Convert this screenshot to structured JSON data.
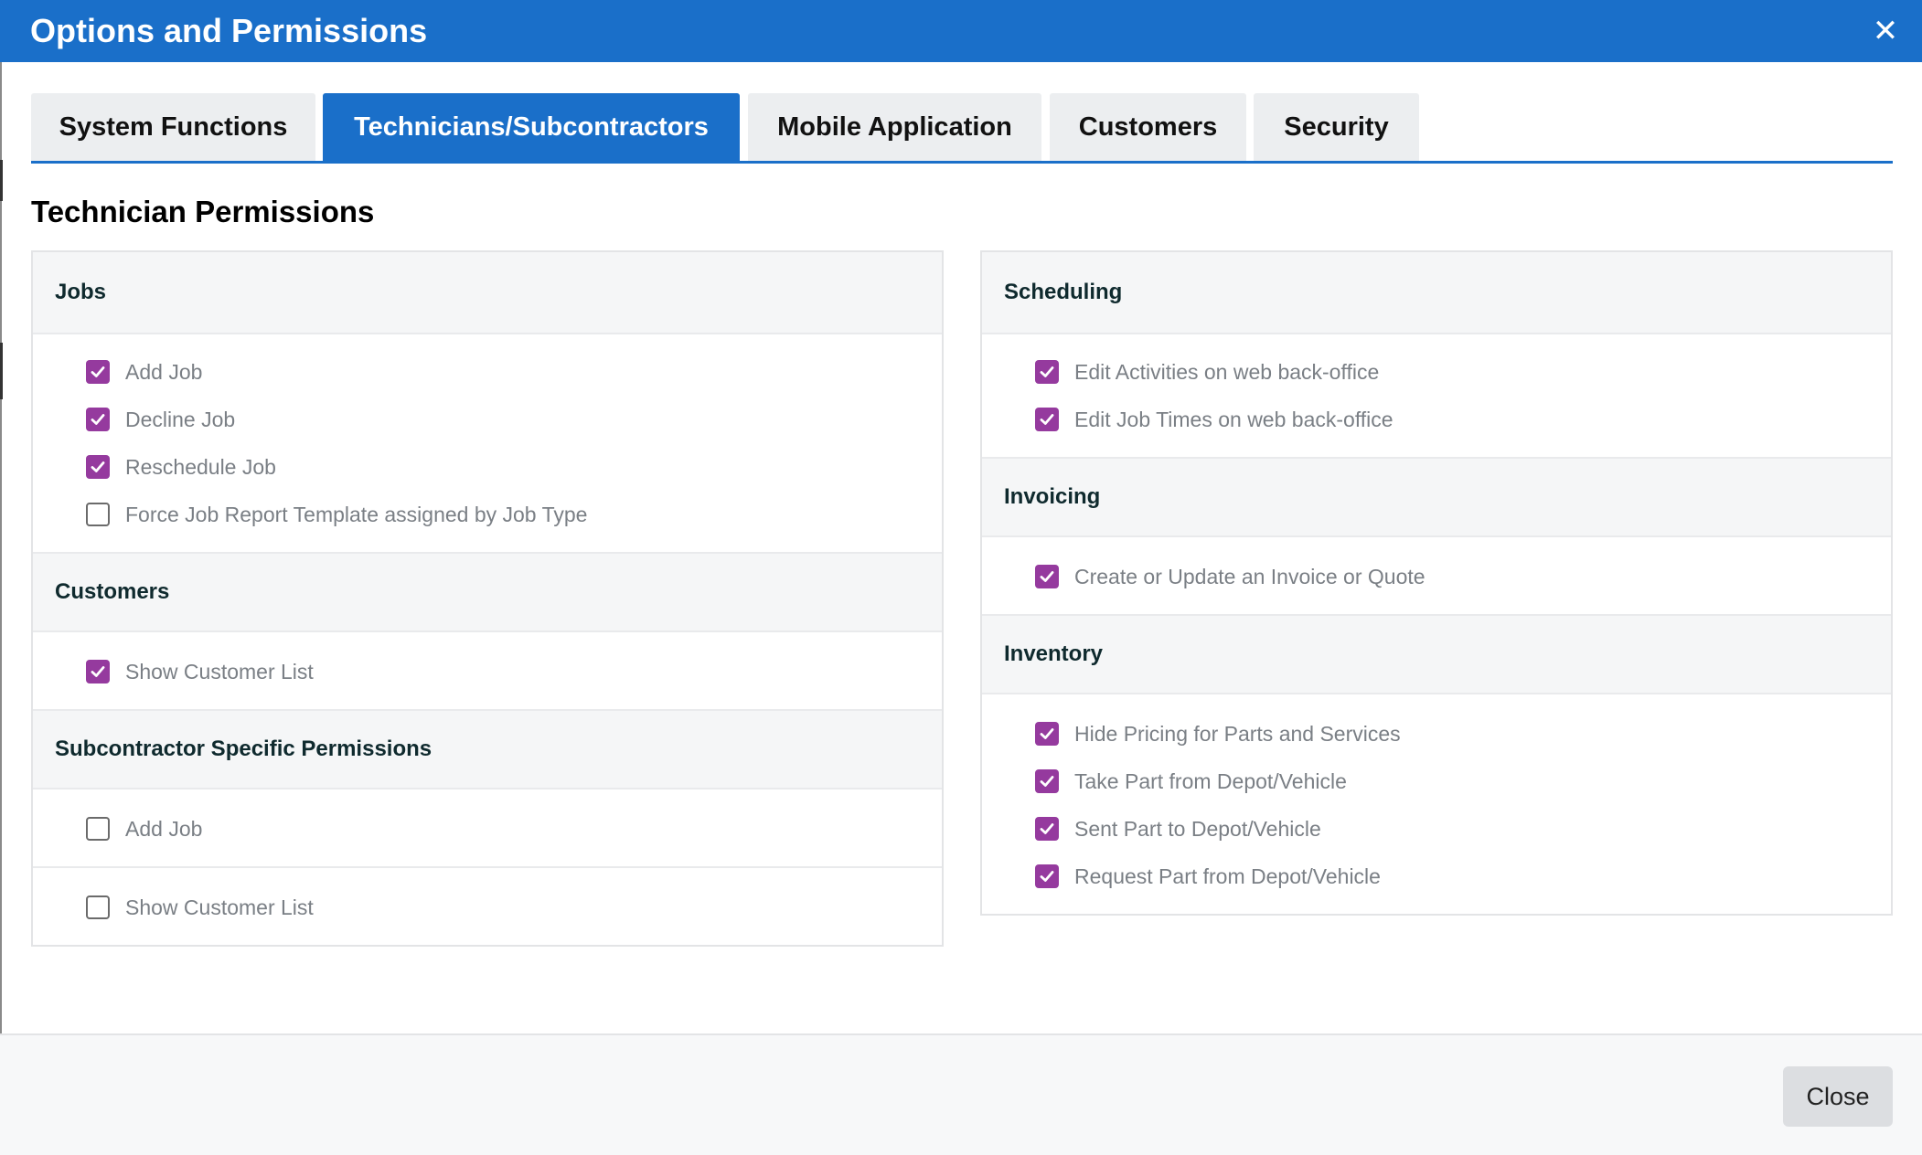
{
  "window": {
    "title": "Options and Permissions",
    "close_icon": "close-icon",
    "accent_color": "#1a6fc9",
    "checkbox_color": "#953a9e"
  },
  "tabs": [
    {
      "label": "System Functions",
      "active": false
    },
    {
      "label": "Technicians/Subcontractors",
      "active": true
    },
    {
      "label": "Mobile Application",
      "active": false
    },
    {
      "label": "Customers",
      "active": false
    },
    {
      "label": "Security",
      "active": false
    }
  ],
  "page": {
    "section_title": "Technician Permissions"
  },
  "left_panel": {
    "jobs": {
      "title": "Jobs",
      "options": [
        {
          "label": "Add Job",
          "checked": true
        },
        {
          "label": "Decline Job",
          "checked": true
        },
        {
          "label": "Reschedule Job",
          "checked": true
        },
        {
          "label": "Force Job Report Template assigned by Job Type",
          "checked": false
        }
      ]
    },
    "customers": {
      "title": "Customers",
      "options": [
        {
          "label": "Show Customer List",
          "checked": true
        }
      ]
    },
    "subcontractor": {
      "title": "Subcontractor Specific Permissions",
      "options": [
        {
          "label": "Add Job",
          "checked": false
        },
        {
          "label": "Show Customer List",
          "checked": false
        }
      ]
    }
  },
  "right_panel": {
    "scheduling": {
      "title": "Scheduling",
      "options": [
        {
          "label": "Edit Activities on web back-office",
          "checked": true
        },
        {
          "label": "Edit Job Times on web back-office",
          "checked": true
        }
      ]
    },
    "invoicing": {
      "title": "Invoicing",
      "options": [
        {
          "label": "Create or Update an Invoice or Quote",
          "checked": true
        }
      ]
    },
    "inventory": {
      "title": "Inventory",
      "options": [
        {
          "label": "Hide Pricing for Parts and Services",
          "checked": true
        },
        {
          "label": "Take Part from Depot/Vehicle",
          "checked": true
        },
        {
          "label": "Sent Part to Depot/Vehicle",
          "checked": true
        },
        {
          "label": "Request Part from Depot/Vehicle",
          "checked": true
        }
      ]
    }
  },
  "footer": {
    "close_label": "Close"
  }
}
